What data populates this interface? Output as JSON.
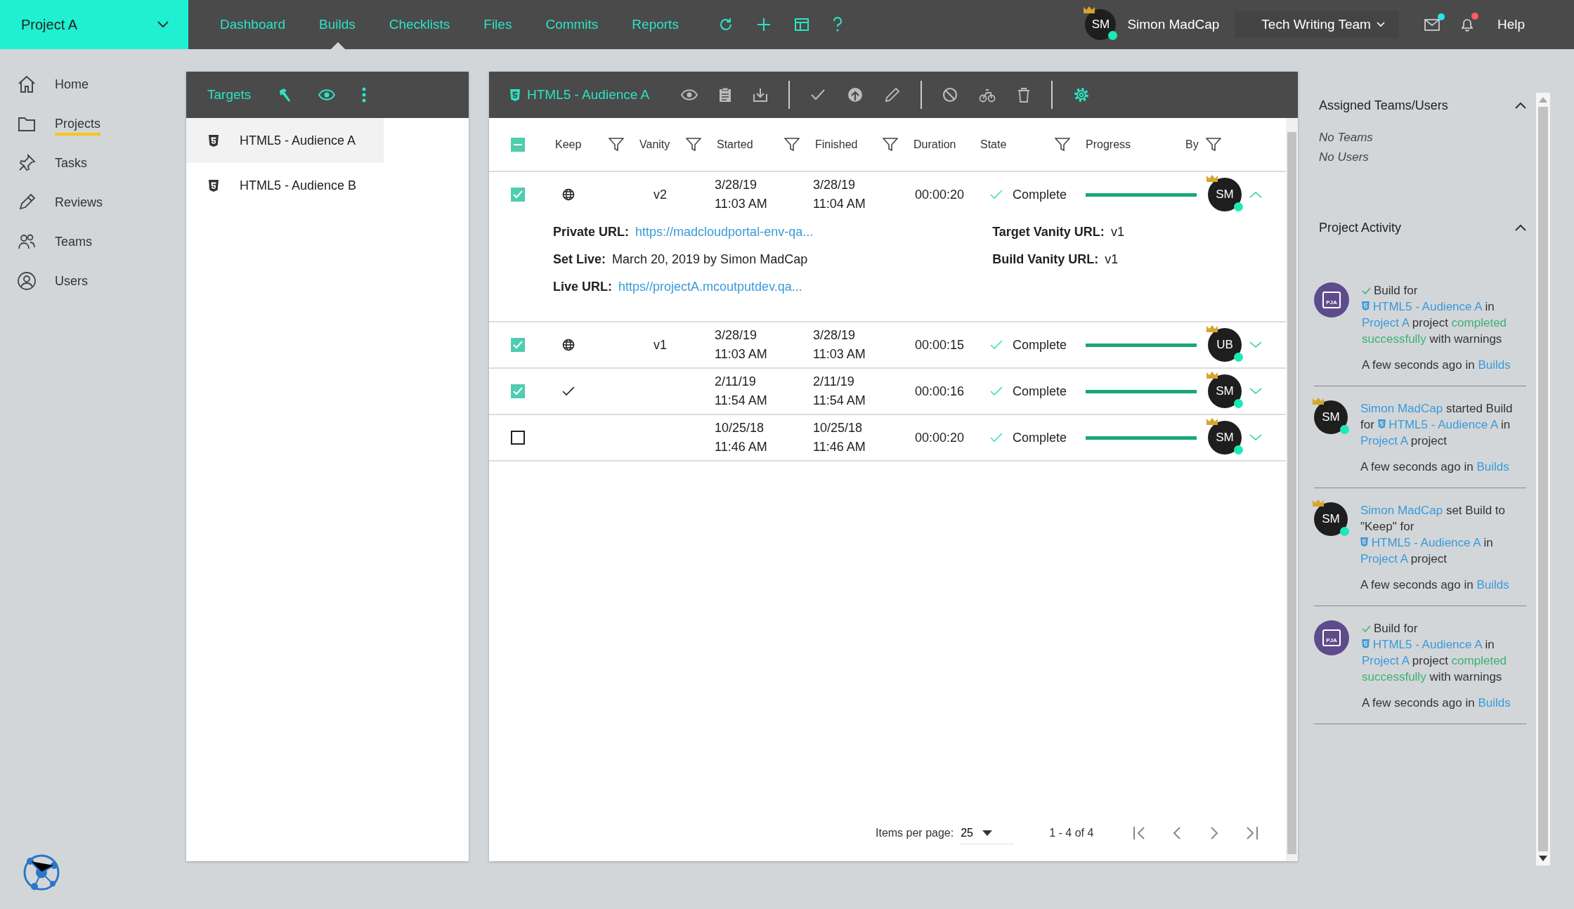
{
  "project_selector": {
    "label": "Project A"
  },
  "nav": [
    {
      "label": "Dashboard",
      "selected": false
    },
    {
      "label": "Builds",
      "selected": true
    },
    {
      "label": "Checklists",
      "selected": false
    },
    {
      "label": "Files",
      "selected": false
    },
    {
      "label": "Commits",
      "selected": false
    },
    {
      "label": "Reports",
      "selected": false
    }
  ],
  "user": {
    "initials": "SM",
    "name": "Simon MadCap"
  },
  "team_selector": {
    "label": "Tech Writing Team"
  },
  "mail_unread": true,
  "alerts_unread": true,
  "help": "Help",
  "sidebar": {
    "items": [
      {
        "label": "Home",
        "kind": "home",
        "selected": false
      },
      {
        "label": "Projects",
        "kind": "folder",
        "selected": true
      },
      {
        "label": "Tasks",
        "kind": "pin",
        "selected": false
      },
      {
        "label": "Reviews",
        "kind": "pen",
        "selected": false
      },
      {
        "label": "Teams",
        "kind": "people",
        "selected": false
      },
      {
        "label": "Users",
        "kind": "person",
        "selected": false
      }
    ]
  },
  "targets": {
    "title": "Targets",
    "items": [
      {
        "label": "HTML5 - Audience A",
        "selected": true
      },
      {
        "label": "HTML5 - Audience B",
        "selected": false
      }
    ]
  },
  "builds": {
    "title": "HTML5 - Audience A",
    "select_all_mixed": true,
    "columns": [
      {
        "label": "Keep",
        "filter": true
      },
      {
        "label": "Vanity",
        "filter": true
      },
      {
        "label": "Started",
        "filter": true
      },
      {
        "label": "Finished",
        "filter": true
      },
      {
        "label": "Duration",
        "filter": false
      },
      {
        "label": "State",
        "filter": true
      },
      {
        "label": "Progress",
        "filter": false
      },
      {
        "label": "By",
        "filter": true
      }
    ],
    "rows": [
      {
        "keep": true,
        "vanity": {
          "kind": "globe",
          "text": "v2"
        },
        "started_date": "3/28/19",
        "started_time": "11:03 AM",
        "finished_date": "3/28/19",
        "finished_time": "11:04 AM",
        "duration": "00:00:20",
        "state": "Complete",
        "level": 1,
        "by": "SM",
        "expanded": true,
        "details_left": [
          {
            "label": "Private URL:",
            "value": "https://madcloudportal-env-qa...",
            "kind": "link"
          },
          {
            "label": "Set Live:",
            "value": "March 20, 2019 by Simon MadCap",
            "kind": "text"
          },
          {
            "label": "Live URL:",
            "value": "https//projectA.mcoutputdev.qa...",
            "kind": "link"
          }
        ],
        "details_right": [
          {
            "label": "Target Vanity URL:",
            "value": "v1",
            "kind": "text"
          },
          {
            "label": "Build Vanity URL:",
            "value": "v1",
            "kind": "text"
          }
        ]
      },
      {
        "keep": true,
        "vanity": {
          "kind": "globe",
          "text": "v1"
        },
        "started_date": "3/28/19",
        "started_time": "11:03 AM",
        "finished_date": "3/28/19",
        "finished_time": "11:03 AM",
        "duration": "00:00:15",
        "state": "Complete",
        "level": 1,
        "by": "UB",
        "expanded": false
      },
      {
        "keep": true,
        "vanity": {
          "kind": "check"
        },
        "started_date": "2/11/19",
        "started_time": "11:54 AM",
        "finished_date": "2/11/19",
        "finished_time": "11:54 AM",
        "duration": "00:00:16",
        "state": "Complete",
        "level": 1,
        "by": "SM",
        "expanded": false
      },
      {
        "keep": false,
        "started_date": "10/25/18",
        "started_time": "11:46 AM",
        "finished_date": "10/25/18",
        "finished_time": "11:46 AM",
        "duration": "00:00:20",
        "state": "Complete",
        "level": 1,
        "by": "SM",
        "expanded": false
      }
    ],
    "pagination": {
      "label": "Items per page:",
      "page_size": "25",
      "range": "1 - 4 of 4"
    }
  },
  "side_panel": {
    "assigned": {
      "title": "Assigned Teams/Users",
      "expanded": true,
      "lines": [
        "No Teams",
        "No Users"
      ]
    },
    "activity": {
      "title": "Project Activity",
      "expanded": true,
      "items": [
        {
          "avatar": {
            "kind": "project",
            "label": "PJA"
          },
          "parts": [
            {
              "kind": "check"
            },
            {
              "kind": "text",
              "text": "Build for"
            },
            {
              "kind": "target",
              "text": "HTML5 - Audience A"
            },
            {
              "kind": "text",
              "text": "in"
            },
            {
              "kind": "link",
              "text": "Project A"
            },
            {
              "kind": "text",
              "text": "project"
            },
            {
              "kind": "success",
              "text": "completed successfully"
            },
            {
              "kind": "text",
              "text": "with warnings"
            }
          ],
          "time": "A few seconds ago in",
          "location": "Builds"
        },
        {
          "avatar": {
            "kind": "user",
            "label": "SM"
          },
          "parts": [
            {
              "kind": "link",
              "text": "Simon MadCap"
            },
            {
              "kind": "text",
              "text": "started Build for"
            },
            {
              "kind": "target",
              "text": "HTML5 - Audience A"
            },
            {
              "kind": "text",
              "text": "in"
            },
            {
              "kind": "link",
              "text": "Project A"
            },
            {
              "kind": "text",
              "text": "project"
            }
          ],
          "time": "A few seconds ago in",
          "location": "Builds"
        },
        {
          "avatar": {
            "kind": "user",
            "label": "SM"
          },
          "parts": [
            {
              "kind": "link",
              "text": "Simon MadCap"
            },
            {
              "kind": "text",
              "text": "set Build to \"Keep\" for"
            },
            {
              "kind": "target",
              "text": "HTML5 - Audience A"
            },
            {
              "kind": "text",
              "text": "in"
            },
            {
              "kind": "link",
              "text": "Project A"
            },
            {
              "kind": "text",
              "text": "project"
            }
          ],
          "time": "A few seconds ago in",
          "location": "Builds"
        },
        {
          "avatar": {
            "kind": "project",
            "label": "PJA"
          },
          "parts": [
            {
              "kind": "check"
            },
            {
              "kind": "text",
              "text": "Build for"
            },
            {
              "kind": "target",
              "text": "HTML5 - Audience A"
            },
            {
              "kind": "text",
              "text": "in"
            },
            {
              "kind": "link",
              "text": "Project A"
            },
            {
              "kind": "text",
              "text": "project"
            },
            {
              "kind": "success",
              "text": "completed successfully"
            },
            {
              "kind": "text",
              "text": "with warnings"
            }
          ],
          "time": "A few seconds ago in",
          "location": "Builds"
        }
      ]
    }
  }
}
